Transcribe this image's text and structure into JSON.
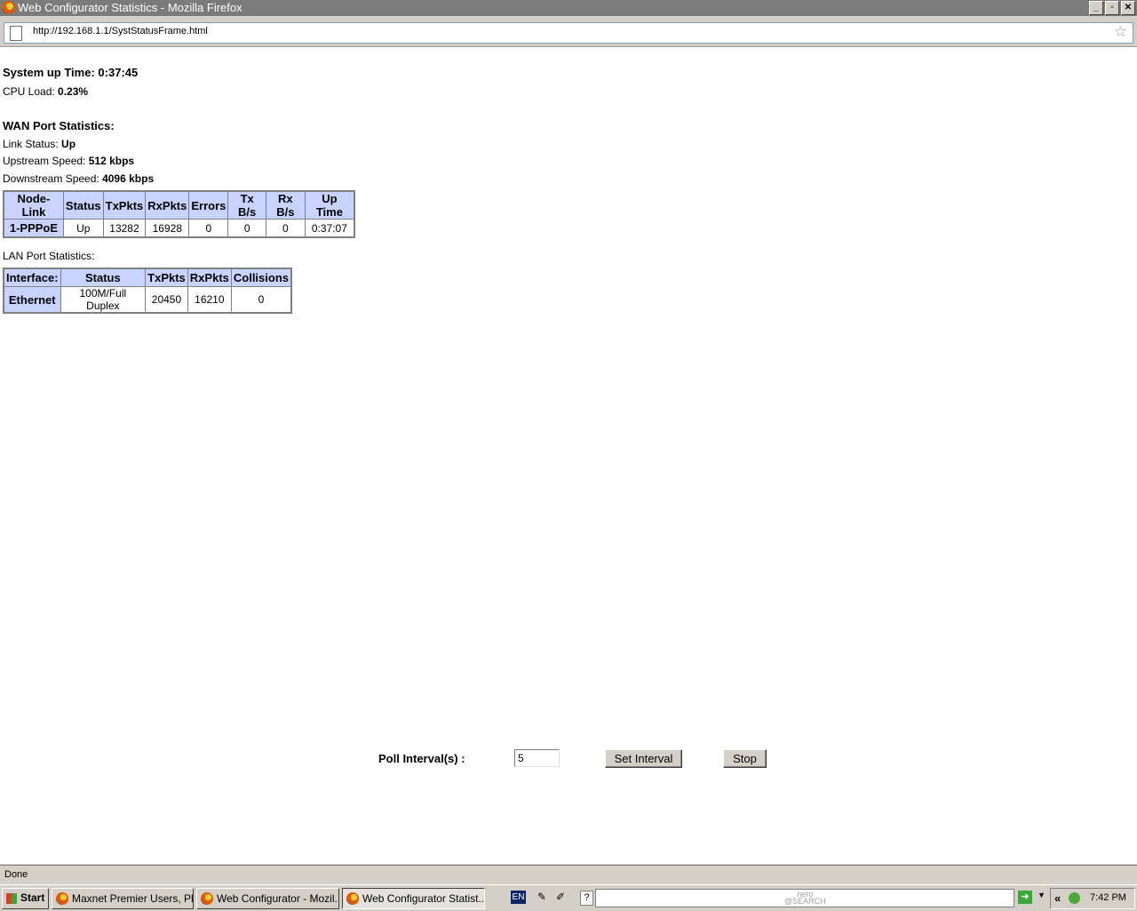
{
  "window": {
    "title": "Web Configurator Statistics - Mozilla Firefox",
    "buttons": {
      "minimize": "_",
      "maximize": "▫",
      "close": "✕"
    }
  },
  "address_bar": {
    "url": "http://192.168.1.1/SystStatusFrame.html",
    "bookmark_icon": "star-icon"
  },
  "system": {
    "uptime_label": "System up Time:",
    "uptime_value": "0:37:45",
    "cpu_label": "CPU Load:",
    "cpu_value": "0.23%"
  },
  "wan": {
    "heading": "WAN Port Statistics:",
    "link_status_label": "Link Status:",
    "link_status_value": "Up",
    "upstream_label": "Upstream Speed:",
    "upstream_value": "512 kbps",
    "downstream_label": "Downstream Speed:",
    "downstream_value": "4096 kbps",
    "table": {
      "headers": [
        "Node-Link",
        "Status",
        "TxPkts",
        "RxPkts",
        "Errors",
        "Tx B/s",
        "Rx B/s",
        "Up Time"
      ],
      "row": [
        "1-PPPoE",
        "Up",
        "13282",
        "16928",
        "0",
        "0",
        "0",
        "0:37:07"
      ]
    }
  },
  "lan": {
    "heading": "LAN Port Statistics:",
    "table": {
      "headers": [
        "Interface:",
        "Status",
        "TxPkts",
        "RxPkts",
        "Collisions"
      ],
      "row": [
        "Ethernet",
        "100M/Full Duplex",
        "20450",
        "16210",
        "0"
      ]
    }
  },
  "poll": {
    "label": "Poll Interval(s) :",
    "value": "5",
    "set_button": "Set Interval",
    "stop_button": "Stop"
  },
  "status_bar": {
    "text": "Done"
  },
  "taskbar": {
    "start_label": "Start",
    "tasks": [
      {
        "label": "Maxnet Premier Users, Pl..."
      },
      {
        "label": "Web Configurator - Mozil..."
      },
      {
        "label": "Web Configurator Statist..."
      }
    ],
    "language": "EN",
    "help": "?",
    "search_brand": "nero",
    "search_brand_sub": "@SEARCH",
    "tray_chevron": "«",
    "clock": "7:42 PM"
  }
}
